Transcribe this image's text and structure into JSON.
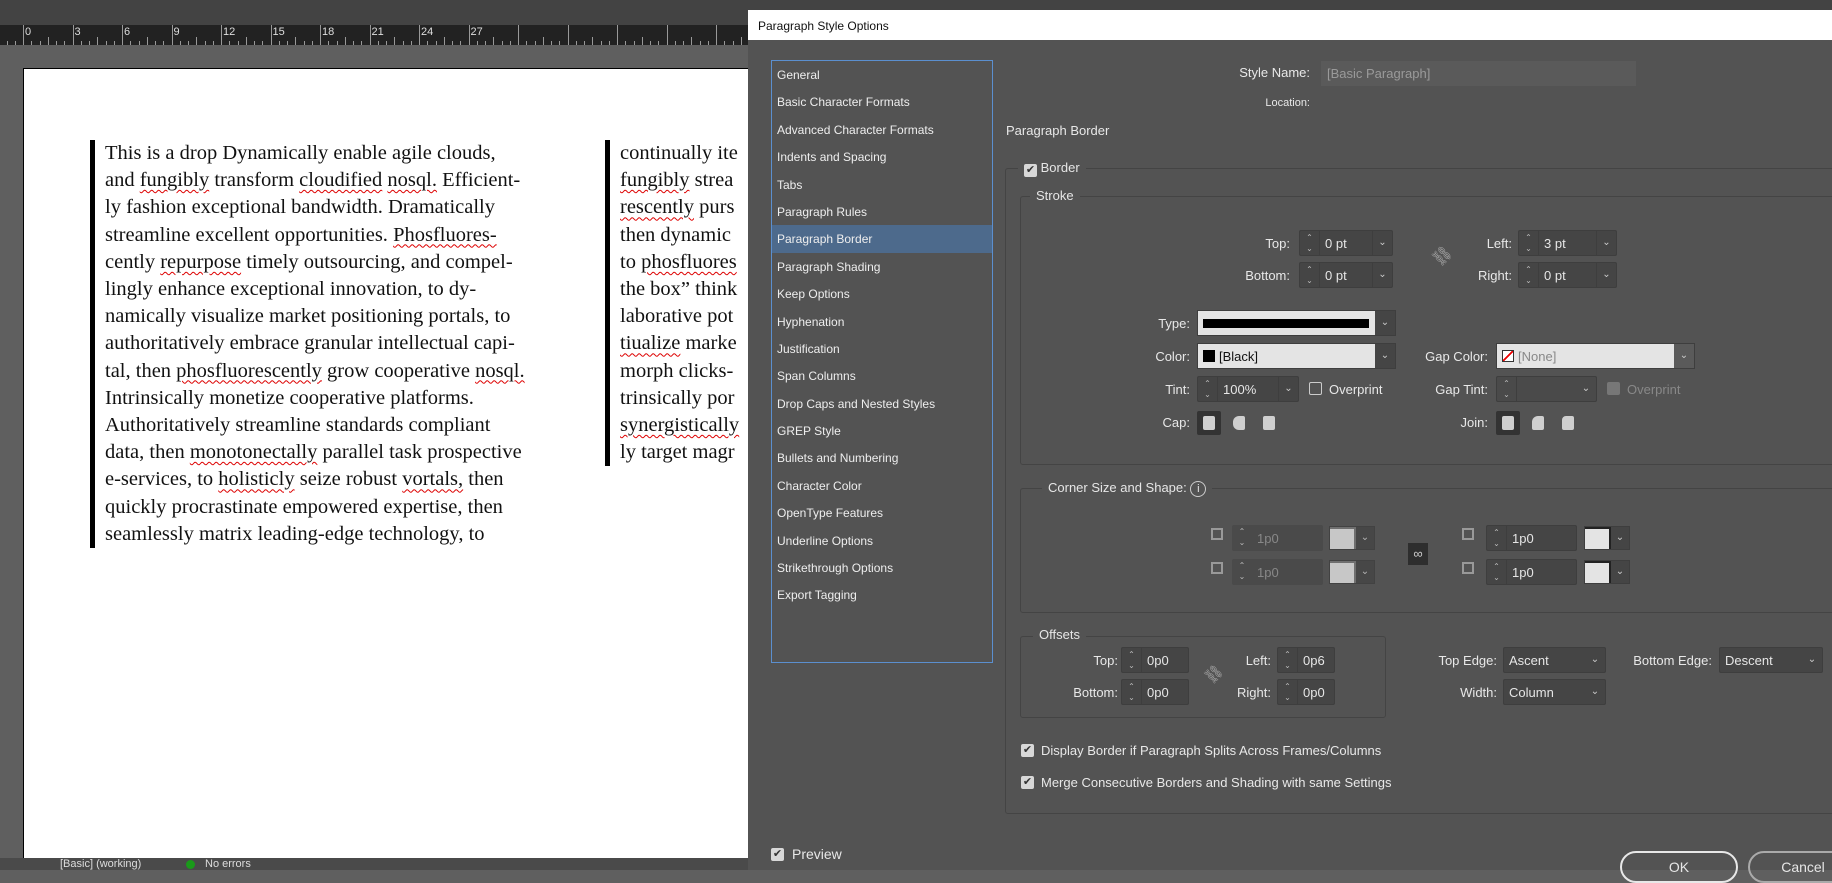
{
  "ruler": {
    "labels": [
      "0",
      "3",
      "6",
      "9",
      "12",
      "15",
      "18",
      "21",
      "24",
      "27"
    ]
  },
  "document": {
    "column1": [
      "This is a drop Dynamically enable agile clouds,",
      "and fungibly transform cloudified nosql. Efficient-",
      "ly fashion exceptional bandwidth. Dramatically",
      "streamline excellent opportunities. Phosfluores-",
      "cently repurpose timely outsourcing, and compel-",
      "lingly enhance exceptional innovation, to dy-",
      "namically visualize market positioning portals, to",
      "authoritatively embrace granular intellectual capi-",
      "tal, then phosfluorescently grow cooperative nosql.",
      "Intrinsically monetize cooperative platforms.",
      "Authoritatively streamline standards compliant",
      "data, then monotonectally parallel task prospective",
      "e-services, to holisticly seize robust vortals, then",
      "quickly procrastinate empowered expertise, then",
      "seamlessly matrix leading-edge technology, to"
    ],
    "column2": [
      "continually ite",
      "fungibly strea",
      "rescently purs",
      "then dynamic",
      "to phosfluores",
      "the box” think",
      "laborative pot",
      "tiualize marke",
      "morph clicks-",
      "trinsically por",
      "synergistically",
      "ly target magr"
    ],
    "misspelled": [
      "fungibly",
      "cloudified",
      "nosql.",
      "Phosfluores-",
      "repurpose",
      "phosfluorescently",
      "monotonectally",
      "holisticly",
      "vortals,",
      "rescently",
      "phosfluores",
      "tiualize",
      "synergistically"
    ]
  },
  "status": {
    "style": "[Basic] (working)",
    "errors": "No errors"
  },
  "dialog": {
    "title": "Paragraph Style Options",
    "categories": [
      "General",
      "Basic Character Formats",
      "Advanced Character Formats",
      "Indents and Spacing",
      "Tabs",
      "Paragraph Rules",
      "Paragraph Border",
      "Paragraph Shading",
      "Keep Options",
      "Hyphenation",
      "Justification",
      "Span Columns",
      "Drop Caps and Nested Styles",
      "GREP Style",
      "Bullets and Numbering",
      "Character Color",
      "OpenType Features",
      "Underline Options",
      "Strikethrough Options",
      "Export Tagging"
    ],
    "selected_category": "Paragraph Border",
    "style_name_label": "Style Name:",
    "style_name": "[Basic Paragraph]",
    "location_label": "Location:",
    "section_title": "Paragraph Border",
    "border_label": "Border",
    "stroke": {
      "title": "Stroke",
      "top_label": "Top:",
      "top": "0 pt",
      "bottom_label": "Bottom:",
      "bottom": "0 pt",
      "left_label": "Left:",
      "left": "3 pt",
      "right_label": "Right:",
      "right": "0 pt",
      "type_label": "Type:",
      "color_label": "Color:",
      "color": "[Black]",
      "gap_color_label": "Gap Color:",
      "gap_color": "[None]",
      "tint_label": "Tint:",
      "tint": "100%",
      "overprint": "Overprint",
      "gap_tint_label": "Gap Tint:",
      "gap_overprint": "Overprint",
      "cap_label": "Cap:",
      "join_label": "Join:"
    },
    "corner": {
      "title": "Corner Size and Shape:",
      "tl": "1p0",
      "bl": "1p0",
      "tr": "1p0",
      "br": "1p0"
    },
    "offsets": {
      "title": "Offsets",
      "top_label": "Top:",
      "top": "0p0",
      "bottom_label": "Bottom:",
      "bottom": "0p0",
      "left_label": "Left:",
      "left": "0p6",
      "right_label": "Right:",
      "right": "0p0"
    },
    "top_edge_label": "Top Edge:",
    "top_edge": "Ascent",
    "bottom_edge_label": "Bottom Edge:",
    "bottom_edge": "Descent",
    "width_label": "Width:",
    "width": "Column",
    "display_border": "Display Border if Paragraph Splits Across Frames/Columns",
    "merge_borders": "Merge Consecutive Borders and Shading with same Settings",
    "preview": "Preview",
    "ok": "OK",
    "cancel": "Cancel"
  }
}
